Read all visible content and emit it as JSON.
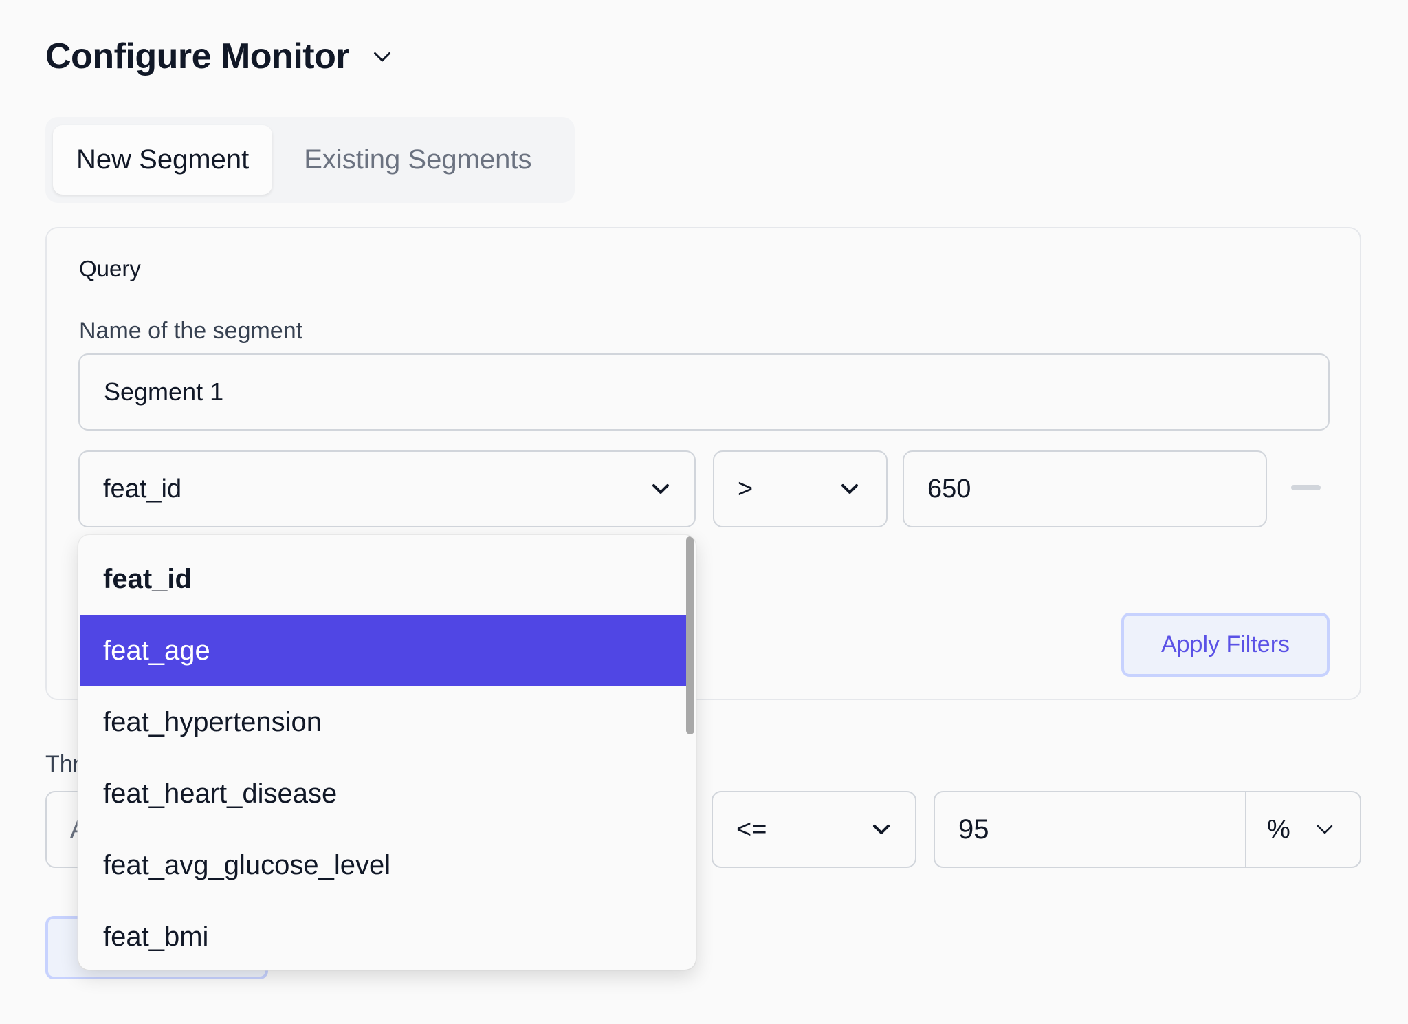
{
  "header": {
    "title": "Configure Monitor",
    "title_chevron_icon": "chevron-down-icon"
  },
  "tabs": [
    {
      "label": "New Segment",
      "active": true
    },
    {
      "label": "Existing Segments",
      "active": false
    }
  ],
  "query": {
    "section_label": "Query",
    "name_label": "Name of the segment",
    "name_value": "Segment 1",
    "filter": {
      "feature": "feat_id",
      "operator": ">",
      "value": "650"
    },
    "apply_label": "Apply Filters"
  },
  "feature_dropdown": {
    "options": [
      {
        "label": "feat_id",
        "selected": true,
        "highlighted": false
      },
      {
        "label": "feat_age",
        "selected": false,
        "highlighted": true
      },
      {
        "label": "feat_hypertension",
        "selected": false,
        "highlighted": false
      },
      {
        "label": "feat_heart_disease",
        "selected": false,
        "highlighted": false
      },
      {
        "label": "feat_avg_glucose_level",
        "selected": false,
        "highlighted": false
      },
      {
        "label": "feat_bmi",
        "selected": false,
        "highlighted": false
      }
    ]
  },
  "threshold": {
    "label_partial": "Thr",
    "metric_partial": "A",
    "comparator": "<=",
    "value": "95",
    "unit": "%"
  },
  "colors": {
    "accent": "#5046e4",
    "accent_text": "#5b52e6",
    "button_bg": "#eef2fb",
    "button_border": "#c7d2fe",
    "border": "#d1d5db",
    "background": "#fafafa"
  }
}
